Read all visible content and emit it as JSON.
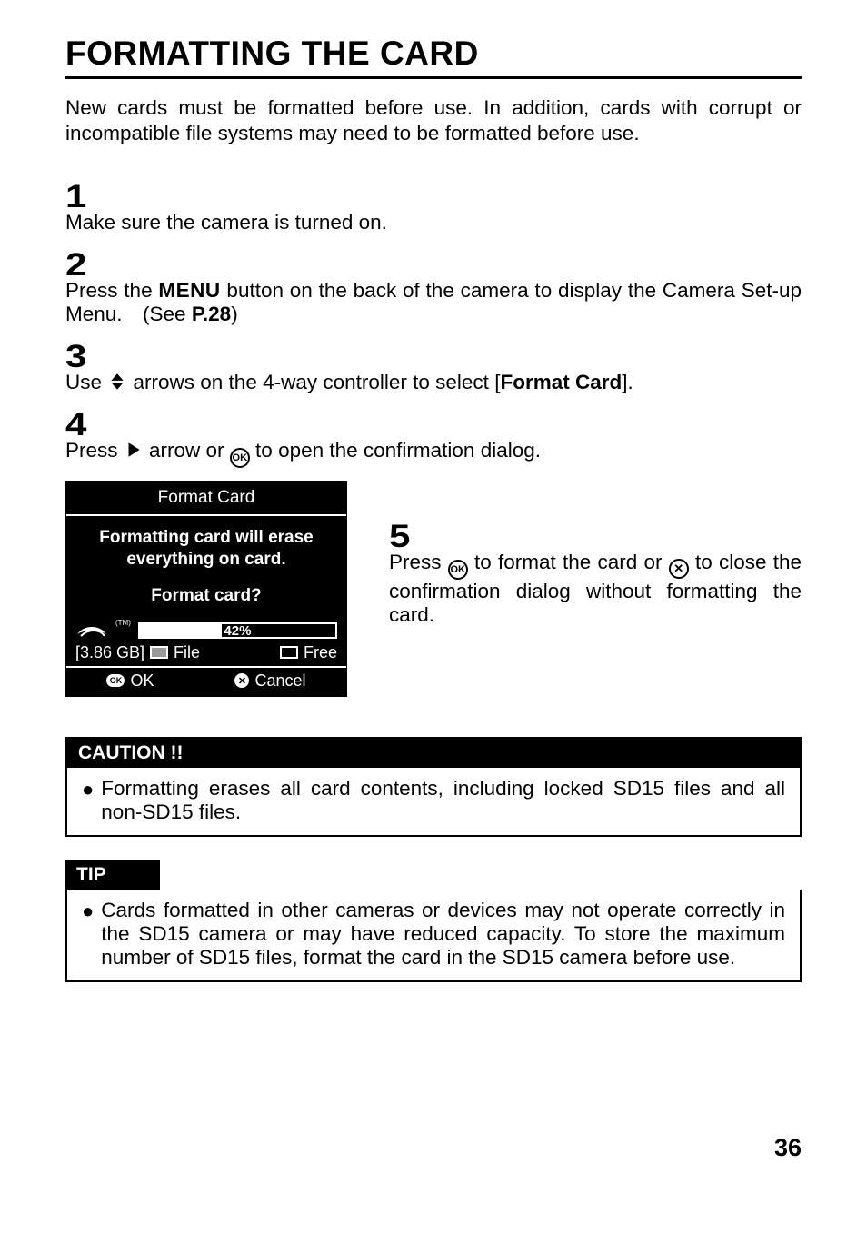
{
  "title": "FORMATTING THE CARD",
  "intro": "New cards must be formatted before use. In addition, cards with corrupt or incompatible file systems may need to be formatted before use.",
  "steps": {
    "s1": {
      "num": "1",
      "text": "Make sure the camera is turned on."
    },
    "s2": {
      "num": "2",
      "pre": "Press the ",
      "menu": "MENU",
      "mid": " button on the back of the camera to display the Camera Set-up Menu. (See ",
      "ref": "P.28",
      "post": ")"
    },
    "s3": {
      "num": "3",
      "pre": "Use ",
      "mid": " arrows on the 4-way controller to select [",
      "opt": "Format Card",
      "post": "]."
    },
    "s4": {
      "num": "4",
      "pre": "Press ",
      "mid": " arrow or ",
      "ok": "OK",
      "post": " to open the confirmation dialog."
    },
    "s5": {
      "num": "5",
      "pre": "Press ",
      "ok": "OK",
      "mid": " to format the card or ",
      "x": "✕",
      "post": " to close the confirmation dialog without formatting the card."
    }
  },
  "dialog": {
    "title": "Format Card",
    "line1": "Formatting card will erase",
    "line2": "everything on card.",
    "question": "Format card?",
    "tm": "(TM)",
    "pct": "42%",
    "pct_value": 42,
    "capacity": "[3.86 GB]",
    "file_label": "File",
    "free_label": "Free",
    "ok": "OK",
    "cancel": "Cancel"
  },
  "caution": {
    "header": "CAUTION !!",
    "text": "Formatting erases all card contents, including locked SD15 files and all non-SD15 files."
  },
  "tip": {
    "header": "TIP",
    "text": "Cards formatted in other cameras or devices may not operate correctly in the SD15 camera or may have reduced capacity. To store the maximum number of SD15 files, format the card in the SD15 camera before use."
  },
  "pageNumber": "36"
}
